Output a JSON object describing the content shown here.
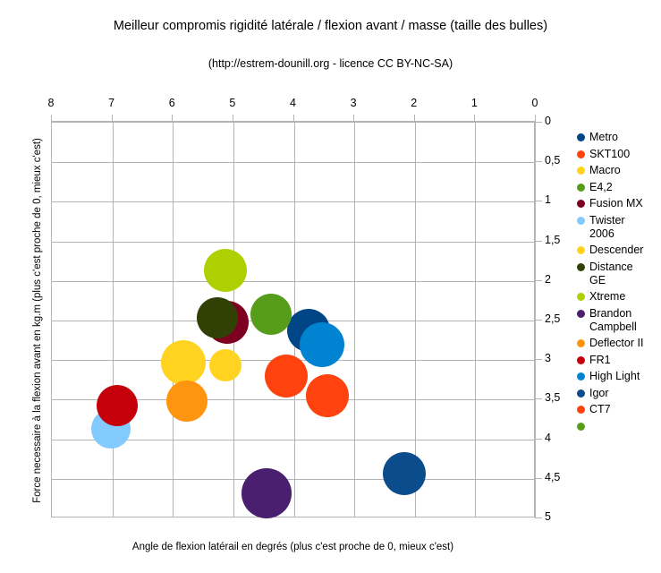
{
  "chart_data": {
    "type": "scatter",
    "title": "Meilleur compromis rigidité latérale / flexion avant / masse (taille des bulles)",
    "subtitle": "(http://estrem-dounill.org - licence CC BY-NC-SA)",
    "xlabel": "Angle de flexion latérail en degrés (plus c'est proche de 0, mieux c'est)",
    "ylabel": "Force necessaire à la flexion avant en kg.m (plus c'est proche de 0, mieux c'est)",
    "xlim": [
      8,
      0
    ],
    "ylim": [
      0,
      5
    ],
    "x_reversed": true,
    "y_axis_position": "right",
    "grid": true,
    "legend_position": "right",
    "xticks": [
      "8",
      "7",
      "6",
      "5",
      "4",
      "3",
      "2",
      "1",
      "0"
    ],
    "xtick_values": [
      8,
      7,
      6,
      5,
      4,
      3,
      2,
      1,
      0
    ],
    "yticks": [
      "0",
      "0,5",
      "1",
      "1,5",
      "2",
      "2,5",
      "3",
      "3,5",
      "4",
      "4,5",
      "5"
    ],
    "ytick_values": [
      0,
      0.5,
      1,
      1.5,
      2,
      2.5,
      3,
      3.5,
      4,
      4.5,
      5
    ],
    "size_meaning": "masse",
    "points": [
      {
        "name": "Metro",
        "x": 3.75,
        "y": 2.62,
        "size": 24,
        "color": "#004586"
      },
      {
        "name": "SKT100",
        "x": 4.12,
        "y": 3.2,
        "size": 24,
        "color": "#FF420E"
      },
      {
        "name": "Macro",
        "x": 5.83,
        "y": 3.03,
        "size": 25,
        "color": "#FFD320"
      },
      {
        "name": "E4,2",
        "x": 4.37,
        "y": 2.42,
        "size": 23,
        "color": "#579D1C"
      },
      {
        "name": "Fusion MX",
        "x": 5.1,
        "y": 2.52,
        "size": 24,
        "color": "#7E0021"
      },
      {
        "name": "Twister 2006",
        "x": 7.02,
        "y": 3.87,
        "size": 22,
        "color": "#83CAFF"
      },
      {
        "name": "Descender",
        "x": 5.13,
        "y": 3.07,
        "size": 18,
        "color": "#FFD320"
      },
      {
        "name": "Distance GE",
        "x": 5.26,
        "y": 2.47,
        "size": 23,
        "color": "#314004"
      },
      {
        "name": "Xtreme",
        "x": 5.13,
        "y": 1.87,
        "size": 24,
        "color": "#AECF00"
      },
      {
        "name": "Brandon Campbell",
        "x": 4.45,
        "y": 4.68,
        "size": 28,
        "color": "#4B1F6F"
      },
      {
        "name": "Deflector II",
        "x": 5.77,
        "y": 3.52,
        "size": 23,
        "color": "#FF950E"
      },
      {
        "name": "FR1",
        "x": 6.92,
        "y": 3.57,
        "size": 23,
        "color": "#C5000B"
      },
      {
        "name": "High Light",
        "x": 3.53,
        "y": 2.8,
        "size": 25,
        "color": "#0084D1"
      },
      {
        "name": "Igor",
        "x": 2.17,
        "y": 4.43,
        "size": 24,
        "color": "#0B4D8C"
      },
      {
        "name": "CT7",
        "x": 3.45,
        "y": 3.45,
        "size": 24,
        "color": "#FF420E"
      }
    ],
    "legend": [
      {
        "label": "Metro",
        "color": "#004586"
      },
      {
        "label": "SKT100",
        "color": "#FF420E"
      },
      {
        "label": "Macro",
        "color": "#FFD320"
      },
      {
        "label": "E4,2",
        "color": "#579D1C"
      },
      {
        "label": "Fusion MX",
        "color": "#7E0021"
      },
      {
        "label": "Twister\n2006",
        "color": "#83CAFF"
      },
      {
        "label": "Descender",
        "color": "#FFD320"
      },
      {
        "label": "Distance\nGE",
        "color": "#314004"
      },
      {
        "label": "Xtreme",
        "color": "#AECF00"
      },
      {
        "label": "Brandon\nCampbell",
        "color": "#4B1F6F"
      },
      {
        "label": "Deflector II",
        "color": "#FF950E"
      },
      {
        "label": "FR1",
        "color": "#C5000B"
      },
      {
        "label": "High Light",
        "color": "#0084D1"
      },
      {
        "label": "Igor",
        "color": "#0B4D8C"
      },
      {
        "label": "CT7",
        "color": "#FF420E"
      },
      {
        "label": "",
        "color": "#579D1C"
      }
    ]
  }
}
